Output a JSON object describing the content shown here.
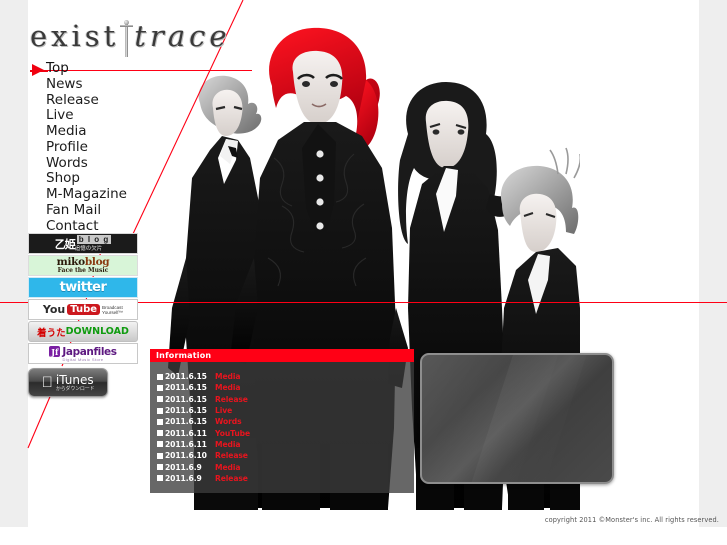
{
  "site": {
    "logo_part1": "exist",
    "logo_separator": "dagger-icon",
    "logo_part2": "trace"
  },
  "nav": {
    "items": [
      {
        "label": "Top",
        "active": true
      },
      {
        "label": "News",
        "active": false
      },
      {
        "label": "Release",
        "active": false
      },
      {
        "label": "Live",
        "active": false
      },
      {
        "label": "Media",
        "active": false
      },
      {
        "label": "Profile",
        "active": false
      },
      {
        "label": "Words",
        "active": false
      },
      {
        "label": "Shop",
        "active": false
      },
      {
        "label": "M-Magazine",
        "active": false
      },
      {
        "label": "Fan Mail",
        "active": false
      },
      {
        "label": "Contact",
        "active": false
      }
    ]
  },
  "banners": {
    "otome": {
      "title": "乙姫",
      "tag": "b l o g",
      "sub": "追憶の欠片"
    },
    "miko": {
      "line1_a": "miko",
      "line1_b": "blog",
      "line2": "Face the Music"
    },
    "twitter": {
      "label": "twitter"
    },
    "youtube": {
      "you": "You",
      "tube": "Tube",
      "broadcast_line1": "Broadcast",
      "broadcast_line2": "Yourself™"
    },
    "download": {
      "jp": "着うた",
      "en": "DOWNLOAD"
    },
    "japanfiles": {
      "mark": "Jf",
      "name": "Japanfiles",
      "sub": "Digital Music Store"
    },
    "itunes": {
      "apple_icon": "apple-icon",
      "main": "iTunes",
      "sub": "からダウンロード"
    }
  },
  "information": {
    "header": "Information",
    "entries": [
      {
        "date": "2011.6.15",
        "category": "Media"
      },
      {
        "date": "2011.6.15",
        "category": "Media"
      },
      {
        "date": "2011.6.15",
        "category": "Release"
      },
      {
        "date": "2011.6.15",
        "category": "Live"
      },
      {
        "date": "2011.6.15",
        "category": "Words"
      },
      {
        "date": "2011.6.11",
        "category": "YouTube"
      },
      {
        "date": "2011.6.11",
        "category": "Media"
      },
      {
        "date": "2011.6.10",
        "category": "Release"
      },
      {
        "date": "2011.6.9",
        "category": "Media"
      },
      {
        "date": "2011.6.9",
        "category": "Release"
      }
    ]
  },
  "media_player": {
    "name": "media-player-panel"
  },
  "footer": {
    "copyright": "copyright 2011 ©Monster's inc. All rights reserved."
  },
  "colors": {
    "accent_red": "#ff0015",
    "category_red": "#e8141e",
    "page_bg": "#eeeeee",
    "panel_gray": "rgba(60,60,60,0.78)"
  }
}
